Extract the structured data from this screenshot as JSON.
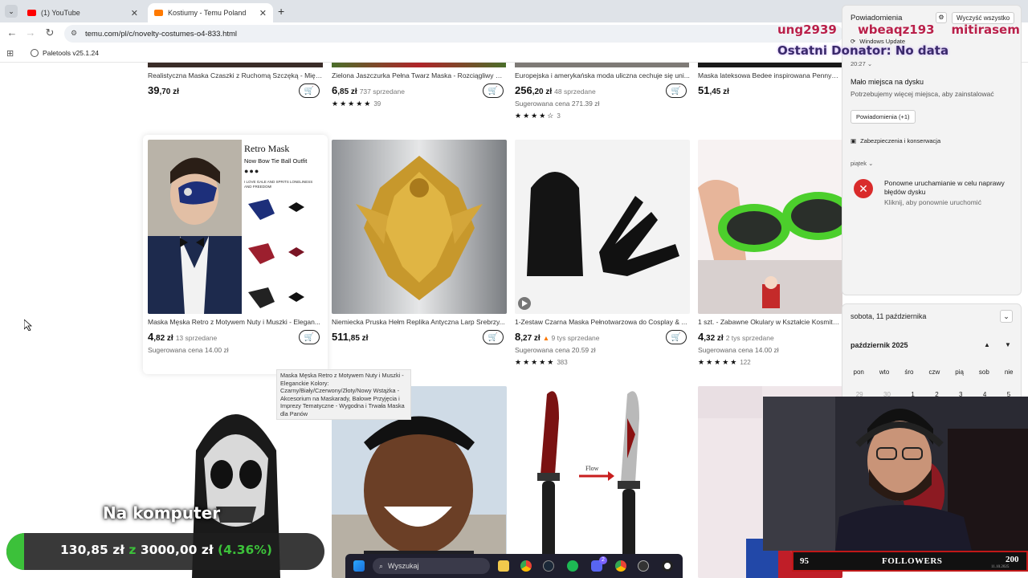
{
  "tabs": [
    {
      "label": "(1) YouTube",
      "color": "#ff0000"
    },
    {
      "label": "Kostiumy - Temu Poland",
      "color": "#ff7a00"
    }
  ],
  "address_bar": {
    "url": "temu.com/pl/c/novelty-costumes-o4-833.html"
  },
  "bookmarks": [
    {
      "label": "Paletools v25.1.24"
    }
  ],
  "top_row": [
    {
      "title": "Realistyczna Maska Czaszki z Ruchomą Szczęką - Międ...",
      "price_main": "39",
      "price_dec": ",70 zł",
      "sold": ""
    },
    {
      "title": "Zielona Jaszczurka Pełna Twarz Maska - Rozciągliwy Sp...",
      "price_main": "6",
      "price_dec": ",85 zł",
      "sold": "737 sprzedane",
      "stars": "★★★★★",
      "reviews": "39"
    },
    {
      "title": "Europejska i amerykańska moda uliczna cechuje się uni...",
      "price_main": "256",
      "price_dec": ",20 zł",
      "sold": "48 sprzedane",
      "suggested": "Sugerowana cena 271.39 zł",
      "stars": "★★★★☆",
      "reviews": "3"
    },
    {
      "title": "Maska lateksowa Bedee inspirowana Pennywise",
      "price_main": "51",
      "price_dec": ",45 zł",
      "sold": ""
    }
  ],
  "products": [
    {
      "title": "Maska Męska Retro z Motywem Nuty i Muszki - Elegan...",
      "price_main": "4",
      "price_dec": ",82 zł",
      "sold": "13 sprzedane",
      "suggested": "Sugerowana cena 14.00 zł",
      "img_heading": "Retro Mask",
      "img_sub": "Now Bow Tie Ball Outfit",
      "img_small": "I LOVE GALE AND SPRITS LONELINESS AND FREEDOM!"
    },
    {
      "title": "Niemiecka Pruska Hełm Replika Antyczna Larp Srebrzy...",
      "price_main": "511",
      "price_dec": ",85 zł",
      "sold": ""
    },
    {
      "title": "1-Zestaw Czarna Maska Pełnotwarzowa do Cosplay & ...",
      "price_main": "8",
      "price_dec": ",27 zł",
      "sold": "9 tys sprzedane",
      "suggested": "Sugerowana cena 20.59 zł",
      "stars": "★★★★★",
      "reviews": "383"
    },
    {
      "title": "1 szt. - Zabawne Okulary w Kształcie Kosmitka...",
      "price_main": "4",
      "price_dec": ",32 zł",
      "sold": "2 tys sprzedane",
      "suggested": "Sugerowana cena 14.00 zł",
      "stars": "★★★★★",
      "reviews": "122"
    }
  ],
  "bottom_images": [
    {
      "name": "ghost-balaclava"
    },
    {
      "name": "smiling-man-mask"
    },
    {
      "name": "bloody-knife-prop",
      "label": "Flow"
    },
    {
      "name": "spiderman-costume"
    }
  ],
  "tooltip": "Maska Męska Retro z Motywem Nuty i Muszki - Eleganckie Kolory: Czarny/Biały/Czerwony/Złoty/Nowy Wstążka - Akcesorium na Maskarady, Balowe Przyjęcia i Imprezy Tematyczne - Wygodna i Trwała Maska dla Panów",
  "notifications": {
    "header": "Powiadomienia",
    "clear_all": "Wyczyść wszystko",
    "source": "Windows Update",
    "time": "20:27",
    "title": "Mało miejsca na dysku",
    "body": "Potrzebujemy więcej miejsca, aby zainstalować",
    "more": "Powiadomienia (+1)",
    "security": "Zabezpieczenia i konserwacja",
    "day": "piątek",
    "err_title": "Ponowne uruchamianie w celu naprawy błędów dysku",
    "err_body": "Kliknij, aby ponownie uruchomić"
  },
  "calendar": {
    "date_label": "sobota, 11 października",
    "month": "październik 2025",
    "weekdays": [
      "pon",
      "wto",
      "śro",
      "czw",
      "pią",
      "sob",
      "nie"
    ],
    "days": [
      "29",
      "30",
      "1",
      "2",
      "3",
      "4",
      "5"
    ]
  },
  "overlays": {
    "names_line": "ung2939     wbeaqz193    mitirasem",
    "donator": "Ostatni Donator: No data",
    "subtitle": "Na komputer",
    "goal_current": "130,85 zł",
    "goal_sep": "z",
    "goal_target": "3000,00 zł",
    "goal_percent": "(4.36%)",
    "goal_progress": 0.0436
  },
  "taskbar": {
    "search_placeholder": "Wyszukaj",
    "discord_badge": "2"
  },
  "followers": {
    "current": "95",
    "label": "FOLLOWERS",
    "goal": "200",
    "date": "11.10.2025"
  },
  "colors": {
    "accent_orange": "#fb7701",
    "green": "#3cc13a",
    "overlay_purple": "#c7a6ff",
    "followers_red": "#c01818"
  }
}
